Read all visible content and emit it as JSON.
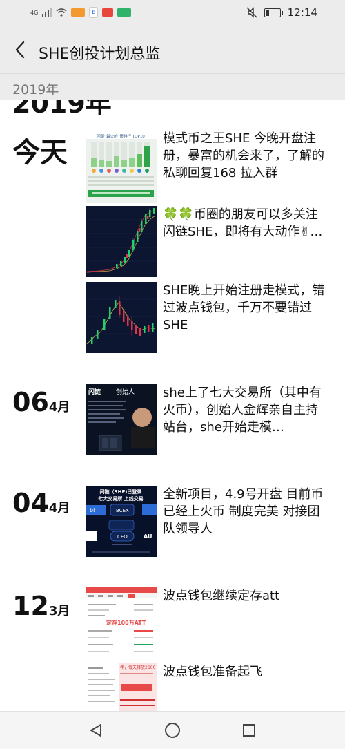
{
  "status_bar": {
    "network": "4G",
    "time": "12:14"
  },
  "header": {
    "title": "SHE创投计划总监"
  },
  "sticky_year": "2019年",
  "year_heading": "2019年",
  "groups": [
    {
      "date_label": "今天",
      "entries": [
        {
          "text": "模式币之王SHE 今晚开盘注册，暴富的机会来了，了解的私聊回复168  拉入群",
          "thumb_title": "闪链“最火的”币排行 TOP10"
        },
        {
          "text": "🍀🍀币圈的朋友可以多关注闪链SHE，即将有大动作✌…"
        },
        {
          "text": "SHE晚上开始注册走模式，错过波点钱包，千万不要错过SHE"
        }
      ]
    },
    {
      "day": "06",
      "month": "4月",
      "entries": [
        {
          "text": "she上了七大交易所（其中有火币），创始人金辉亲自主持站台，she开始走模…",
          "thumb_left": "闪链",
          "thumb_right": "创始人"
        }
      ]
    },
    {
      "day": "04",
      "month": "4月",
      "entries": [
        {
          "text": "全新项目，4.9号开盘  目前币已经上火币  制度完美  对接团队领导人",
          "thumb_line1": "闪链（SHE)已登录",
          "thumb_line2": "七大交易所 上线交易",
          "thumb_labels": [
            "BCEX",
            "CEO",
            "bi",
            "AU"
          ]
        }
      ]
    },
    {
      "day": "12",
      "month": "3月",
      "entries": [
        {
          "text": "波点钱包继续定存att",
          "thumb_overlay": "定存100万ATT"
        },
        {
          "text": "波点钱包准备起飞",
          "thumb_overlay": "年，每天释放2600"
        }
      ]
    }
  ],
  "colors": {
    "bar_bg": "#ececec",
    "nav_bg": "#f5f5f5",
    "chart_bg": "#0d1630",
    "up": "#1fd46b",
    "down": "#e0334a"
  },
  "nav": {
    "icons": [
      "back-triangle-icon",
      "home-circle-icon",
      "recents-square-icon"
    ]
  }
}
